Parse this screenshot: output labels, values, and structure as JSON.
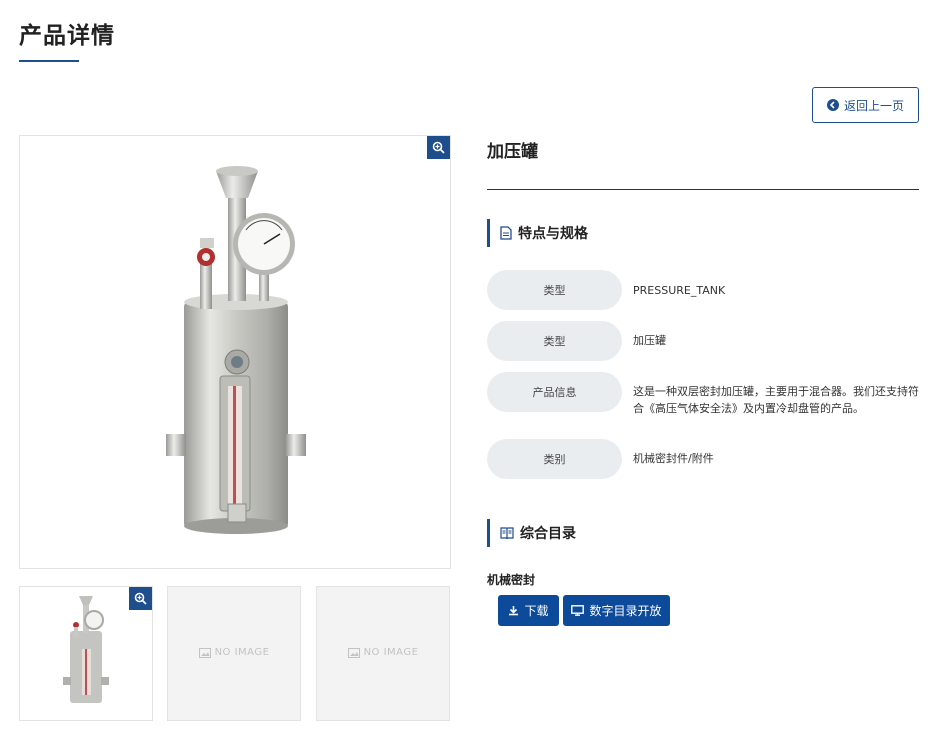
{
  "page": {
    "title": "产品详情"
  },
  "back_button": {
    "label": "返回上一页"
  },
  "product": {
    "name": "加压罐",
    "images": {
      "no_image_text": "NO IMAGE"
    }
  },
  "spec_section": {
    "title": "特点与规格",
    "rows": [
      {
        "label": "类型",
        "value": "PRESSURE_TANK"
      },
      {
        "label": "类型",
        "value": "加压罐"
      },
      {
        "label": "产品信息",
        "value": "这是一种双层密封加压罐，主要用于混合器。我们还支持符合《高压气体安全法》及内置冷却盘管的产品。"
      },
      {
        "label": "类别",
        "value": "机械密封件/附件"
      }
    ]
  },
  "catalog_section": {
    "title": "综合目录",
    "category": "机械密封",
    "download_label": "下载",
    "digital_catalog_label": "数字目录开放"
  },
  "colors": {
    "accent": "#1f4e8c",
    "button": "#0d4a9a",
    "pill": "#eaedf0"
  },
  "icons": [
    "arrow-left-circle-icon",
    "zoom-in-icon",
    "document-icon",
    "book-icon",
    "download-icon",
    "monitor-icon",
    "image-icon"
  ]
}
